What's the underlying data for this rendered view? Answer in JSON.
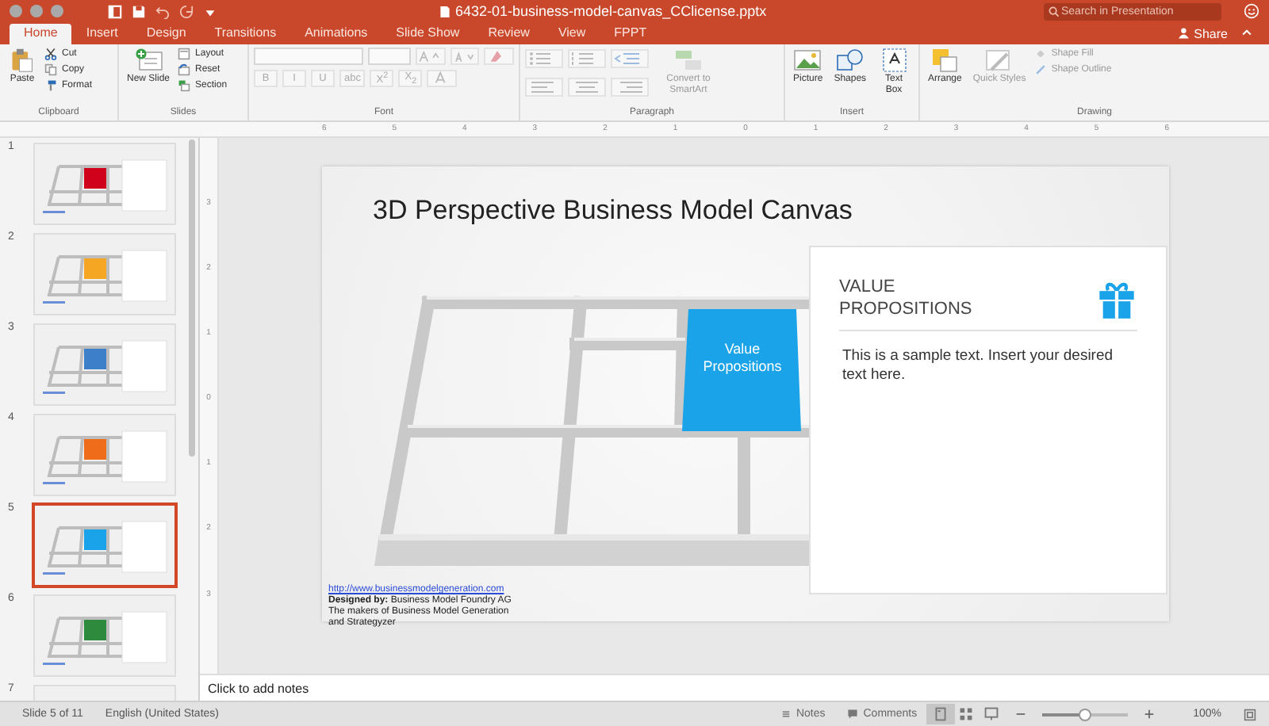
{
  "window": {
    "title": "6432-01-business-model-canvas_CClicense.pptx"
  },
  "search": {
    "placeholder": "Search in Presentation"
  },
  "tabs": [
    {
      "label": "Home",
      "selected": true
    },
    {
      "label": "Insert",
      "selected": false
    },
    {
      "label": "Design",
      "selected": false
    },
    {
      "label": "Transitions",
      "selected": false
    },
    {
      "label": "Animations",
      "selected": false
    },
    {
      "label": "Slide Show",
      "selected": false
    },
    {
      "label": "Review",
      "selected": false
    },
    {
      "label": "View",
      "selected": false
    },
    {
      "label": "FPPT",
      "selected": false
    }
  ],
  "share": "Share",
  "clipboard": {
    "label": "Clipboard",
    "paste": "Paste",
    "cut": "Cut",
    "copy": "Copy",
    "format": "Format"
  },
  "slides_group": {
    "label": "Slides",
    "new_slide": "New Slide",
    "layout": "Layout",
    "reset": "Reset",
    "section": "Section"
  },
  "font": {
    "label": "Font",
    "buttons": [
      "B",
      "I",
      "U",
      "abc",
      "X$^{2}$",
      "X$_{2}$"
    ]
  },
  "paragraph": {
    "label": "Paragraph",
    "convert": "Convert to SmartArt"
  },
  "insert_group": {
    "label": "Insert",
    "picture": "Picture",
    "shapes": "Shapes",
    "text_box": "Text Box"
  },
  "drawing": {
    "label": "Drawing",
    "arrange": "Arrange",
    "quick_styles": "Quick Styles",
    "shape_fill": "Shape Fill",
    "shape_outline": "Shape Outline"
  },
  "ruler": {
    "labels": [
      "6",
      "5",
      "4",
      "3",
      "2",
      "1",
      "0",
      "1",
      "2",
      "3",
      "4",
      "5",
      "6"
    ],
    "vertical_labels": [
      "3",
      "2",
      "1",
      "0",
      "1",
      "2",
      "3"
    ]
  },
  "thumbnails": [
    {
      "number": "1",
      "selected": false,
      "color": "#d0021b"
    },
    {
      "number": "2",
      "selected": false,
      "color": "#f5a623"
    },
    {
      "number": "3",
      "selected": false,
      "color": "#3d7fc9"
    },
    {
      "number": "4",
      "selected": false,
      "color": "#ef6c1a"
    },
    {
      "number": "5",
      "selected": true,
      "color": "#1aa3e8"
    },
    {
      "number": "6",
      "selected": false,
      "color": "#2e8b3e"
    },
    {
      "number": "7",
      "selected": false
    }
  ],
  "slide": {
    "title": "3D Perspective Business Model Canvas",
    "block_label": "Value Propositions",
    "card": {
      "heading": "VALUE PROPOSITIONS",
      "body": "This is a sample text. Insert your desired text here."
    },
    "footer": {
      "link": "http://www.businessmodelgeneration.com",
      "lines": [
        "**Designed by:** Business Model Foundry AG",
        "The makers of Business Model Generation",
        "and Strategyzer"
      ]
    }
  },
  "notes": {
    "placeholder": "Click to add notes"
  },
  "status_bar": {
    "slide": "Slide 5 of 11",
    "language": "English (United States)",
    "notes": "Notes",
    "comments": "Comments",
    "views": [
      {
        "kind": "normal",
        "selected": true
      },
      {
        "kind": "sorter",
        "selected": false
      },
      {
        "kind": "reading",
        "selected": false
      }
    ],
    "zoom": {
      "level": 0.5,
      "reading": "100%"
    }
  }
}
